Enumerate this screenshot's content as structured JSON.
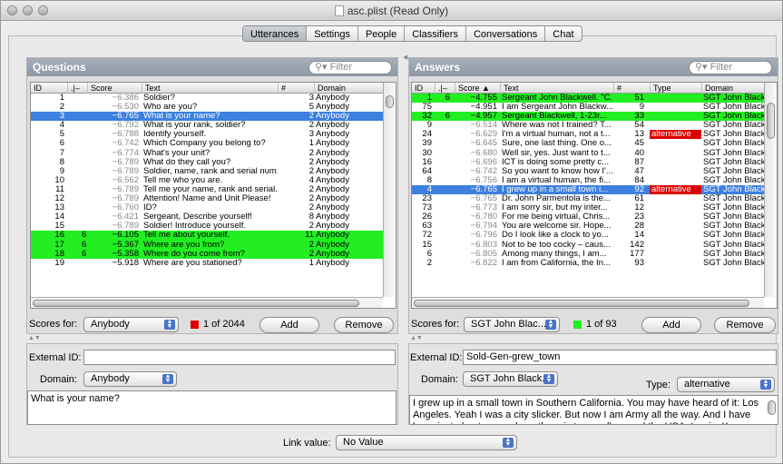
{
  "window": {
    "title": "asc.plist (Read Only)"
  },
  "tabs": [
    {
      "label": "Utterances",
      "selected": true
    },
    {
      "label": "Settings",
      "selected": false
    },
    {
      "label": "People",
      "selected": false
    },
    {
      "label": "Classifiers",
      "selected": false
    },
    {
      "label": "Conversations",
      "selected": false
    },
    {
      "label": "Chat",
      "selected": false
    }
  ],
  "questions": {
    "title": "Questions",
    "filter_placeholder": "Filter",
    "columns": [
      "ID",
      "",
      "Score",
      "Text",
      "#",
      "Domain"
    ],
    "rows": [
      {
        "id": "1",
        "mark": "",
        "score": "−6.386",
        "text": "Soldier?",
        "count": "3",
        "domain": "Anybody",
        "style": ""
      },
      {
        "id": "2",
        "mark": "red",
        "score": "−6.530",
        "text": "Who are you?",
        "count": "5",
        "domain": "Anybody",
        "style": ""
      },
      {
        "id": "3",
        "mark": "red",
        "score": "−6.765",
        "text": "What is your name?",
        "count": "2",
        "domain": "Anybody",
        "style": "sel"
      },
      {
        "id": "4",
        "mark": "",
        "score": "−6.792",
        "text": "What is your rank, soldier?",
        "count": "2",
        "domain": "Anybody",
        "style": ""
      },
      {
        "id": "5",
        "mark": "",
        "score": "−6.788",
        "text": "Identify yourself.",
        "count": "3",
        "domain": "Anybody",
        "style": ""
      },
      {
        "id": "6",
        "mark": "",
        "score": "−6.742",
        "text": "Which Company you belong to?",
        "count": "1",
        "domain": "Anybody",
        "style": ""
      },
      {
        "id": "7",
        "mark": "",
        "score": "−6.774",
        "text": "What's your unit?",
        "count": "2",
        "domain": "Anybody",
        "style": ""
      },
      {
        "id": "8",
        "mark": "",
        "score": "−6.789",
        "text": "What do they call you?",
        "count": "2",
        "domain": "Anybody",
        "style": ""
      },
      {
        "id": "9",
        "mark": "",
        "score": "−6.789",
        "text": "Soldier, name, rank and serial num...",
        "count": "2",
        "domain": "Anybody",
        "style": ""
      },
      {
        "id": "10",
        "mark": "red",
        "score": "−6.562",
        "text": "Tell me who you are.",
        "count": "4",
        "domain": "Anybody",
        "style": ""
      },
      {
        "id": "11",
        "mark": "",
        "score": "−6.789",
        "text": "Tell me your name, rank and serial...",
        "count": "2",
        "domain": "Anybody",
        "style": ""
      },
      {
        "id": "12",
        "mark": "",
        "score": "−6.789",
        "text": "Attention! Name and Unit Please!",
        "count": "2",
        "domain": "Anybody",
        "style": ""
      },
      {
        "id": "13",
        "mark": "",
        "score": "−6.760",
        "text": "ID?",
        "count": "2",
        "domain": "Anybody",
        "style": ""
      },
      {
        "id": "14",
        "mark": "",
        "score": "−6.421",
        "text": "Sergeant, Describe yourself!",
        "count": "8",
        "domain": "Anybody",
        "style": ""
      },
      {
        "id": "15",
        "mark": "",
        "score": "−6.789",
        "text": "Soldier! Introduce yourself.",
        "count": "2",
        "domain": "Anybody",
        "style": ""
      },
      {
        "id": "16",
        "mark": "6",
        "score": "−6.105",
        "text": "Tell me about yourself.",
        "count": "11",
        "domain": "Anybody",
        "style": "green"
      },
      {
        "id": "17",
        "mark": "6",
        "score": "−5.367",
        "text": "Where are you from?",
        "count": "2",
        "domain": "Anybody",
        "style": "green"
      },
      {
        "id": "18",
        "mark": "6",
        "score": "−5.358",
        "text": "Where do you come from?",
        "count": "2",
        "domain": "Anybody",
        "style": "green"
      },
      {
        "id": "19",
        "mark": "",
        "score": "−5.918",
        "text": "Where are you stationed?",
        "count": "1",
        "domain": "Anybody",
        "style": ""
      }
    ],
    "scores_for_label": "Scores for:",
    "scores_for_value": "Anybody",
    "counter": "1 of 2044",
    "counter_color": "#e00000",
    "add_label": "Add",
    "remove_label": "Remove",
    "external_id_label": "External ID:",
    "external_id_value": "",
    "domain_label": "Domain:",
    "domain_value": "Anybody",
    "text_value": "What is your name?"
  },
  "answers": {
    "title": "Answers",
    "filter_placeholder": "Filter",
    "columns": [
      "ID",
      "",
      "Score",
      "Text",
      "#",
      "Type",
      "Domain"
    ],
    "rows": [
      {
        "id": "1",
        "mark": "6",
        "score": "−4.755",
        "text": "Sergeant John Blackwell. \"C...",
        "count": "51",
        "type": "",
        "domain": "SGT John Blackw",
        "style": "green"
      },
      {
        "id": "75",
        "mark": "",
        "score": "−4.951",
        "text": "I am Sergeant John Blackw...",
        "count": "9",
        "type": "",
        "domain": "SGT John Blackw",
        "style": ""
      },
      {
        "id": "32",
        "mark": "6",
        "score": "−4.957",
        "text": "Sergeant Blackwell, 1-23r...",
        "count": "33",
        "type": "",
        "domain": "SGT John Blackw",
        "style": "green"
      },
      {
        "id": "9",
        "mark": "",
        "score": "−6.514",
        "text": "Where was not I trained? T...",
        "count": "54",
        "type": "",
        "domain": "SGT John Blackw",
        "style": ""
      },
      {
        "id": "24",
        "mark": "",
        "score": "−6.629",
        "text": "I'm a virtual human, not a t...",
        "count": "13",
        "type": "alternative",
        "domain": "SGT John Blackw",
        "style": ""
      },
      {
        "id": "39",
        "mark": "",
        "score": "−6.645",
        "text": "Sure, one last thing. One o...",
        "count": "45",
        "type": "",
        "domain": "SGT John Blackw",
        "style": ""
      },
      {
        "id": "30",
        "mark": "",
        "score": "−6.680",
        "text": "Well sir, yes. Just want to t...",
        "count": "40",
        "type": "",
        "domain": "SGT John Blackw",
        "style": ""
      },
      {
        "id": "16",
        "mark": "",
        "score": "−6.696",
        "text": "ICT is doing some pretty c...",
        "count": "87",
        "type": "",
        "domain": "SGT John Blackw",
        "style": ""
      },
      {
        "id": "64",
        "mark": "",
        "score": "−6.742",
        "text": "So you want to know how I'...",
        "count": "47",
        "type": "",
        "domain": "SGT John Blackw",
        "style": ""
      },
      {
        "id": "8",
        "mark": "",
        "score": "−6.756",
        "text": "I am a virtual human, the fi...",
        "count": "84",
        "type": "",
        "domain": "SGT John Blackw",
        "style": ""
      },
      {
        "id": "4",
        "mark": "",
        "score": "−6.765",
        "text": "I grew up in a small town i...",
        "count": "92",
        "type": "alternative",
        "domain": "SGT John Blackw",
        "style": "sel"
      },
      {
        "id": "23",
        "mark": "",
        "score": "−6.765",
        "text": "Dr. John Parmentola is the...",
        "count": "61",
        "type": "",
        "domain": "SGT John Blackw",
        "style": ""
      },
      {
        "id": "73",
        "mark": "",
        "score": "−6.773",
        "text": "I am sorry sir, but my inter...",
        "count": "12",
        "type": "",
        "domain": "SGT John Blackw",
        "style": ""
      },
      {
        "id": "26",
        "mark": "",
        "score": "−6.780",
        "text": "For me being virtual, Chris...",
        "count": "23",
        "type": "",
        "domain": "SGT John Blackw",
        "style": ""
      },
      {
        "id": "63",
        "mark": "",
        "score": "−6.794",
        "text": "You are welcome sir. Hope...",
        "count": "28",
        "type": "",
        "domain": "SGT John Blackw",
        "style": ""
      },
      {
        "id": "72",
        "mark": "",
        "score": "−6.796",
        "text": "Do I look like a clock to yo...",
        "count": "14",
        "type": "",
        "domain": "SGT John Blackw",
        "style": ""
      },
      {
        "id": "15",
        "mark": "",
        "score": "−6.803",
        "text": "Not to be too cocky – caus...",
        "count": "142",
        "type": "",
        "domain": "SGT John Blackw",
        "style": ""
      },
      {
        "id": "6",
        "mark": "",
        "score": "−6.805",
        "text": "Among many things, I am...",
        "count": "177",
        "type": "",
        "domain": "SGT John Blackw",
        "style": ""
      },
      {
        "id": "2",
        "mark": "",
        "score": "−6.822",
        "text": "I am from California, the In...",
        "count": "93",
        "type": "",
        "domain": "SGT John Blackw",
        "style": ""
      }
    ],
    "scores_for_label": "Scores for:",
    "scores_for_value": "SGT John Blac...",
    "counter": "1 of 93",
    "counter_color": "#22ee22",
    "add_label": "Add",
    "remove_label": "Remove",
    "external_id_label": "External ID:",
    "external_id_value": "Sold-Gen-grew_town",
    "domain_label": "Domain:",
    "domain_value": "SGT John Black...",
    "type_label": "Type:",
    "type_value": "alternative",
    "text_value": "I grew up in a small town in Southern California. You may have heard of it: Los Angeles. Yeah I was a city slicker. But now I am Army all the way. And I have been just about everywhere there is to go: all around the USA, Lewis, Knox, Polk, Irwin."
  },
  "link": {
    "label": "Link value:",
    "value": "No Value"
  }
}
